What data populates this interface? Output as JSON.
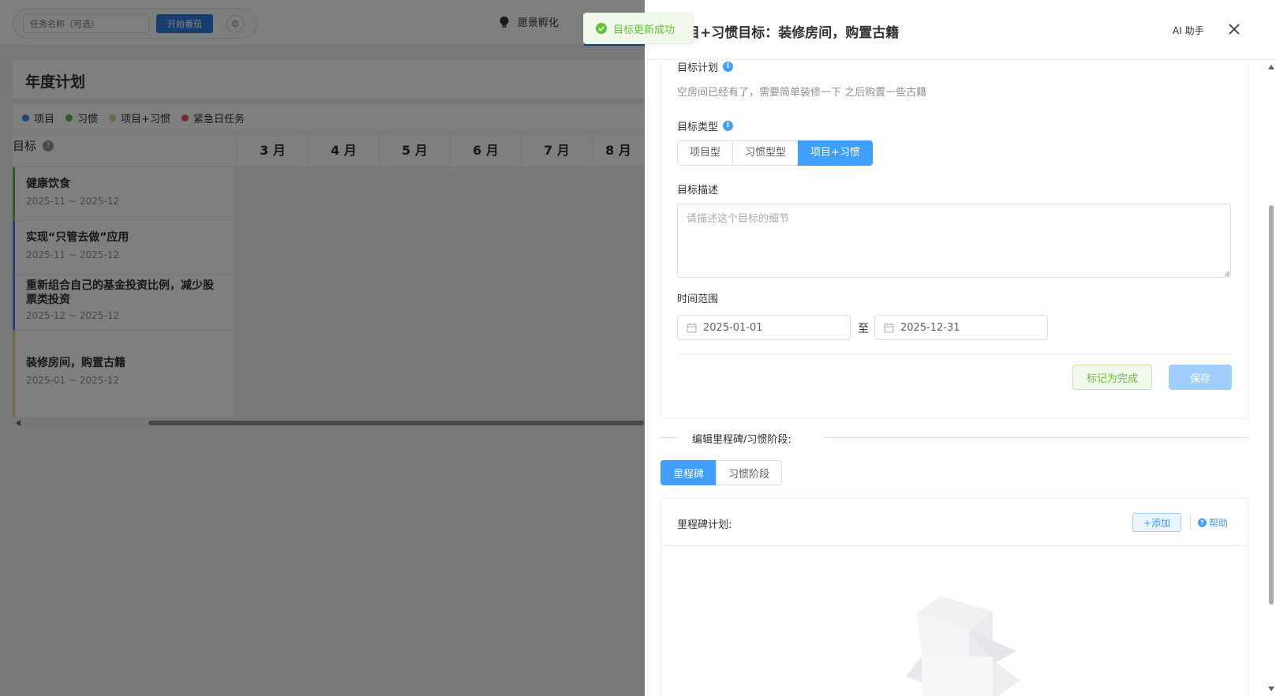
{
  "topbar": {
    "task_placeholder": "任务名称（可选）",
    "start_button": "开始番茄",
    "wish_label": "愿景孵化"
  },
  "plan": {
    "title": "年度计划",
    "legend": [
      {
        "label": "项目",
        "color": "#4a86e8"
      },
      {
        "label": "习惯",
        "color": "#5fb84a"
      },
      {
        "label": "项目+习惯",
        "color": "#e6cf8c"
      },
      {
        "label": "紧急日任务",
        "color": "#e85a5a"
      }
    ],
    "goal_column": "目标",
    "months": [
      "3 月",
      "4 月",
      "5 月",
      "6 月",
      "7 月",
      "8 月"
    ],
    "goals": [
      {
        "title": "健康饮食",
        "range": "2025-11 ~ 2025-12",
        "color": "#5fb84a"
      },
      {
        "title": "实现“只管去做”应用",
        "range": "2025-11 ~ 2025-12",
        "color": "#4a86e8"
      },
      {
        "title": "重新组合自己的基金投资比例，减少股票类投资",
        "range": "2025-12 ~ 2025-12",
        "color": "#4a86e8"
      },
      {
        "title": "装修房间，购置古籍",
        "range": "2025-01 ~ 2025-12",
        "color": "#e6cf8c"
      }
    ]
  },
  "toast": {
    "message": "目标更新成功"
  },
  "drawer": {
    "title": "项目+习惯目标：装修房间，购置古籍",
    "ai_button": "AI 助手",
    "form": {
      "plan_label": "目标计划",
      "plan_text": "空房间已经有了，需要简单装修一下 之后购置一些古籍",
      "type_label": "目标类型",
      "types": [
        "项目型",
        "习惯型型",
        "项目+习惯"
      ],
      "active_type": 2,
      "desc_label": "目标描述",
      "desc_placeholder": "请描述这个目标的细节",
      "time_label": "时间范围",
      "start_date": "2025-01-01",
      "separator": "至",
      "end_date": "2025-12-31",
      "mark_done_button": "标记为完成",
      "save_button": "保存"
    },
    "milestones": {
      "section_title": "编辑里程碑/习惯阶段:",
      "tabs": [
        "里程碑",
        "习惯阶段"
      ],
      "active_tab": 0,
      "card_title": "里程碑计划:",
      "add_button": "+添加",
      "help_button": "帮助"
    }
  }
}
